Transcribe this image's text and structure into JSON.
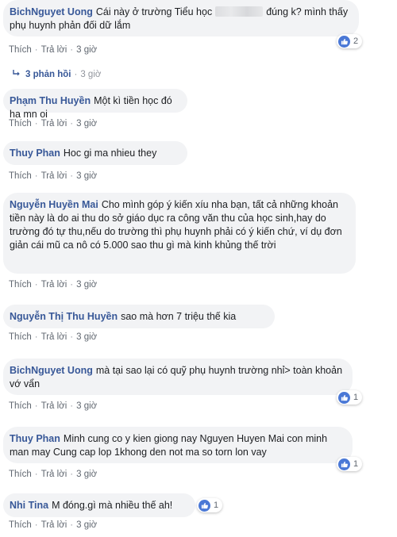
{
  "comments": [
    {
      "author": "BichNguyet Uong",
      "text_before": "Cái này ở trường Tiểu học",
      "text_after": "đúng k? mình thấy phụ huynh phản đối dữ lắm",
      "like": "Thích",
      "reply": "Trả lời",
      "time": "3 giờ",
      "reactions": "2"
    },
    {
      "author": "Phạm Thu Huyền",
      "text": "Một kì tiền học đó ha mn oi",
      "like": "Thích",
      "reply": "Trả lời",
      "time": "3 giờ"
    },
    {
      "author": "Thuy Phan",
      "text": "Hoc gi ma nhieu they",
      "like": "Thích",
      "reply": "Trả lời",
      "time": "3 giờ"
    },
    {
      "author": "Nguyễn Huyền Mai",
      "text": "Cho mình góp ý kiến xíu nha bạn, tất cả những khoản tiền này là do ai thu do sở giáo dục ra công văn thu của học sinh,hay do trường đó tự thu,nếu do trường thì phụ huynh phải có ý kiến chứ, ví dụ đơn giản cái mũ ca nô có 5.000 sao thu gì mà kinh khủng thế trời",
      "like": "Thích",
      "reply": "Trả lời",
      "time": "3 giờ"
    },
    {
      "author": "Nguyễn Thị Thu Huyền",
      "text": "sao mà hơn 7 triệu thế kia",
      "like": "Thích",
      "reply": "Trả lời",
      "time": "3 giờ"
    },
    {
      "author": "BichNguyet Uong",
      "text": "mà tại sao lại có quỹ phụ huynh trường nhỉ> toàn khoản vớ vẩn",
      "like": "Thích",
      "reply": "Trả lời",
      "time": "3 giờ",
      "reactions": "1"
    },
    {
      "author": "Thuy Phan",
      "text": "Minh cung co y kien giong nay Nguyen Huyen Mai con minh man may Cung cap lop 1khong den not ma so torn lon vay",
      "like": "Thích",
      "reply": "Trả lời",
      "time": "3 giờ",
      "reactions": "1"
    },
    {
      "author": "Nhi Tina",
      "text": "M đóng.gì mà nhiều thế ah!",
      "like": "Thích",
      "reply": "Trả lời",
      "time": "3 giờ",
      "reactions": "1"
    }
  ],
  "replies_link": {
    "label": "3 phản hồi",
    "time": "3 giờ"
  },
  "colors": {
    "author": "#385898",
    "bubble": "#f2f3f5",
    "meta": "#606770",
    "like": "#4a78d6"
  },
  "icons": {
    "reaction": "like-icon",
    "reply_arrow": "reply-arrow-icon"
  }
}
